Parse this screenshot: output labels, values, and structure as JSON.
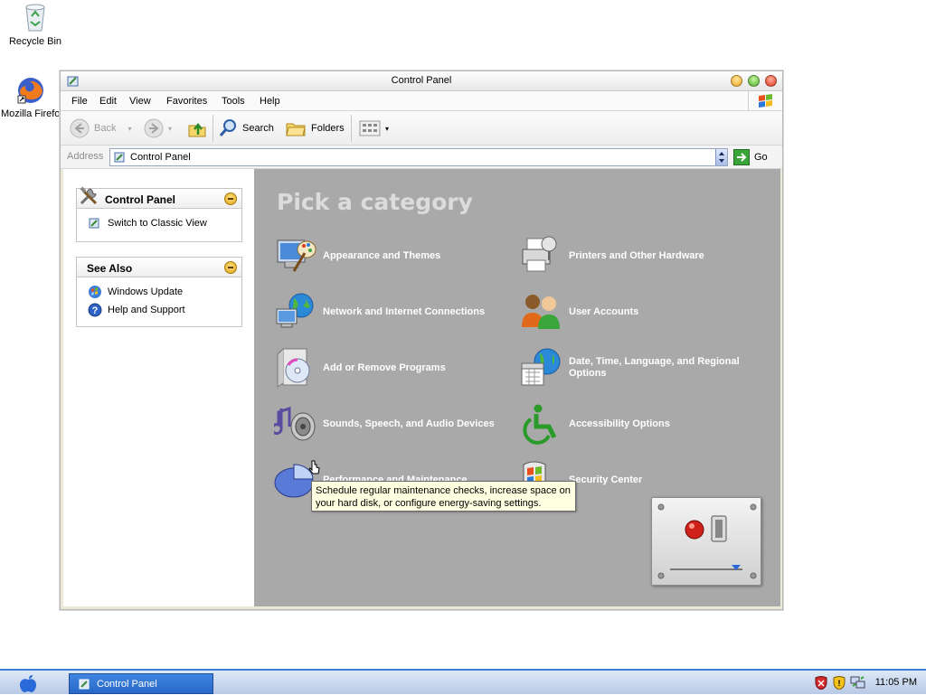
{
  "desktop": {
    "icons": [
      {
        "label": "Recycle Bin",
        "icon": "recycle-bin-icon"
      },
      {
        "label": "Mozilla Firefox",
        "icon": "firefox-icon"
      }
    ]
  },
  "window": {
    "title": "Control Panel",
    "menu": [
      "File",
      "Edit",
      "View",
      "Favorites",
      "Tools",
      "Help"
    ],
    "toolbar": {
      "back": "Back",
      "search": "Search",
      "folders": "Folders"
    },
    "address": {
      "label": "Address",
      "value": "Control Panel",
      "go": "Go"
    }
  },
  "left_pane": {
    "control_panel": {
      "title": "Control Panel",
      "items": [
        "Switch to Classic View"
      ]
    },
    "see_also": {
      "title": "See Also",
      "items": [
        "Windows Update",
        "Help and Support"
      ]
    }
  },
  "main": {
    "heading": "Pick a category",
    "categories": [
      {
        "label": "Appearance and Themes",
        "icon": "appearance-themes-icon"
      },
      {
        "label": "Printers and Other Hardware",
        "icon": "printer-icon"
      },
      {
        "label": "Network and Internet Connections",
        "icon": "network-globe-icon"
      },
      {
        "label": "User Accounts",
        "icon": "user-accounts-icon"
      },
      {
        "label": "Add or Remove Programs",
        "icon": "add-remove-programs-icon"
      },
      {
        "label": "Date, Time, Language, and Regional Options",
        "icon": "calendar-globe-icon"
      },
      {
        "label": "Sounds, Speech, and Audio Devices",
        "icon": "speaker-note-icon"
      },
      {
        "label": "Accessibility Options",
        "icon": "accessibility-icon"
      },
      {
        "label": "Performance and Maintenance",
        "icon": "pie-chart-icon"
      },
      {
        "label": "Security Center",
        "icon": "shield-icon"
      }
    ],
    "tooltip": "Schedule regular maintenance checks, increase space on your hard disk, or configure energy-saving settings."
  },
  "taskbar": {
    "task_label": "Control Panel",
    "clock": "11:05 PM"
  },
  "colors": {
    "category_pane": "#a9a9a9",
    "tooltip_bg": "#ffffe1",
    "taskbar_accent": "#3c7fd8"
  }
}
